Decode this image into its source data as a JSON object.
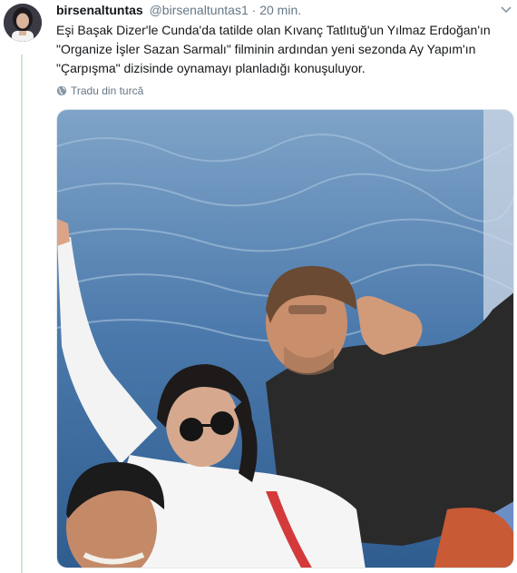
{
  "tweet": {
    "display_name": "birsenaltuntas",
    "handle": "@birsenaltuntas1",
    "separator": "·",
    "time": "20 min.",
    "text_lines": [
      "Eşi Başak Dizer'le Cunda'da tatilde olan Kıvanç Tatlıtuğ'un Yılmaz Erdoğan'ın",
      "\"Organize İşler Sazan Sarmalı\" filminin ardından yeni sezonda Ay Yapım'ın",
      "\"Çarpışma\" dizisinde oynamayı planladığı konuşuluyor."
    ],
    "translate_label": "Tradu din turcă"
  },
  "colors": {
    "thread": "#c8ead1",
    "muted": "#657786",
    "text": "#14171a",
    "sea": "#3f6fa3"
  },
  "icons": {
    "menu": "chevron-down-icon",
    "translate": "globe-icon"
  }
}
